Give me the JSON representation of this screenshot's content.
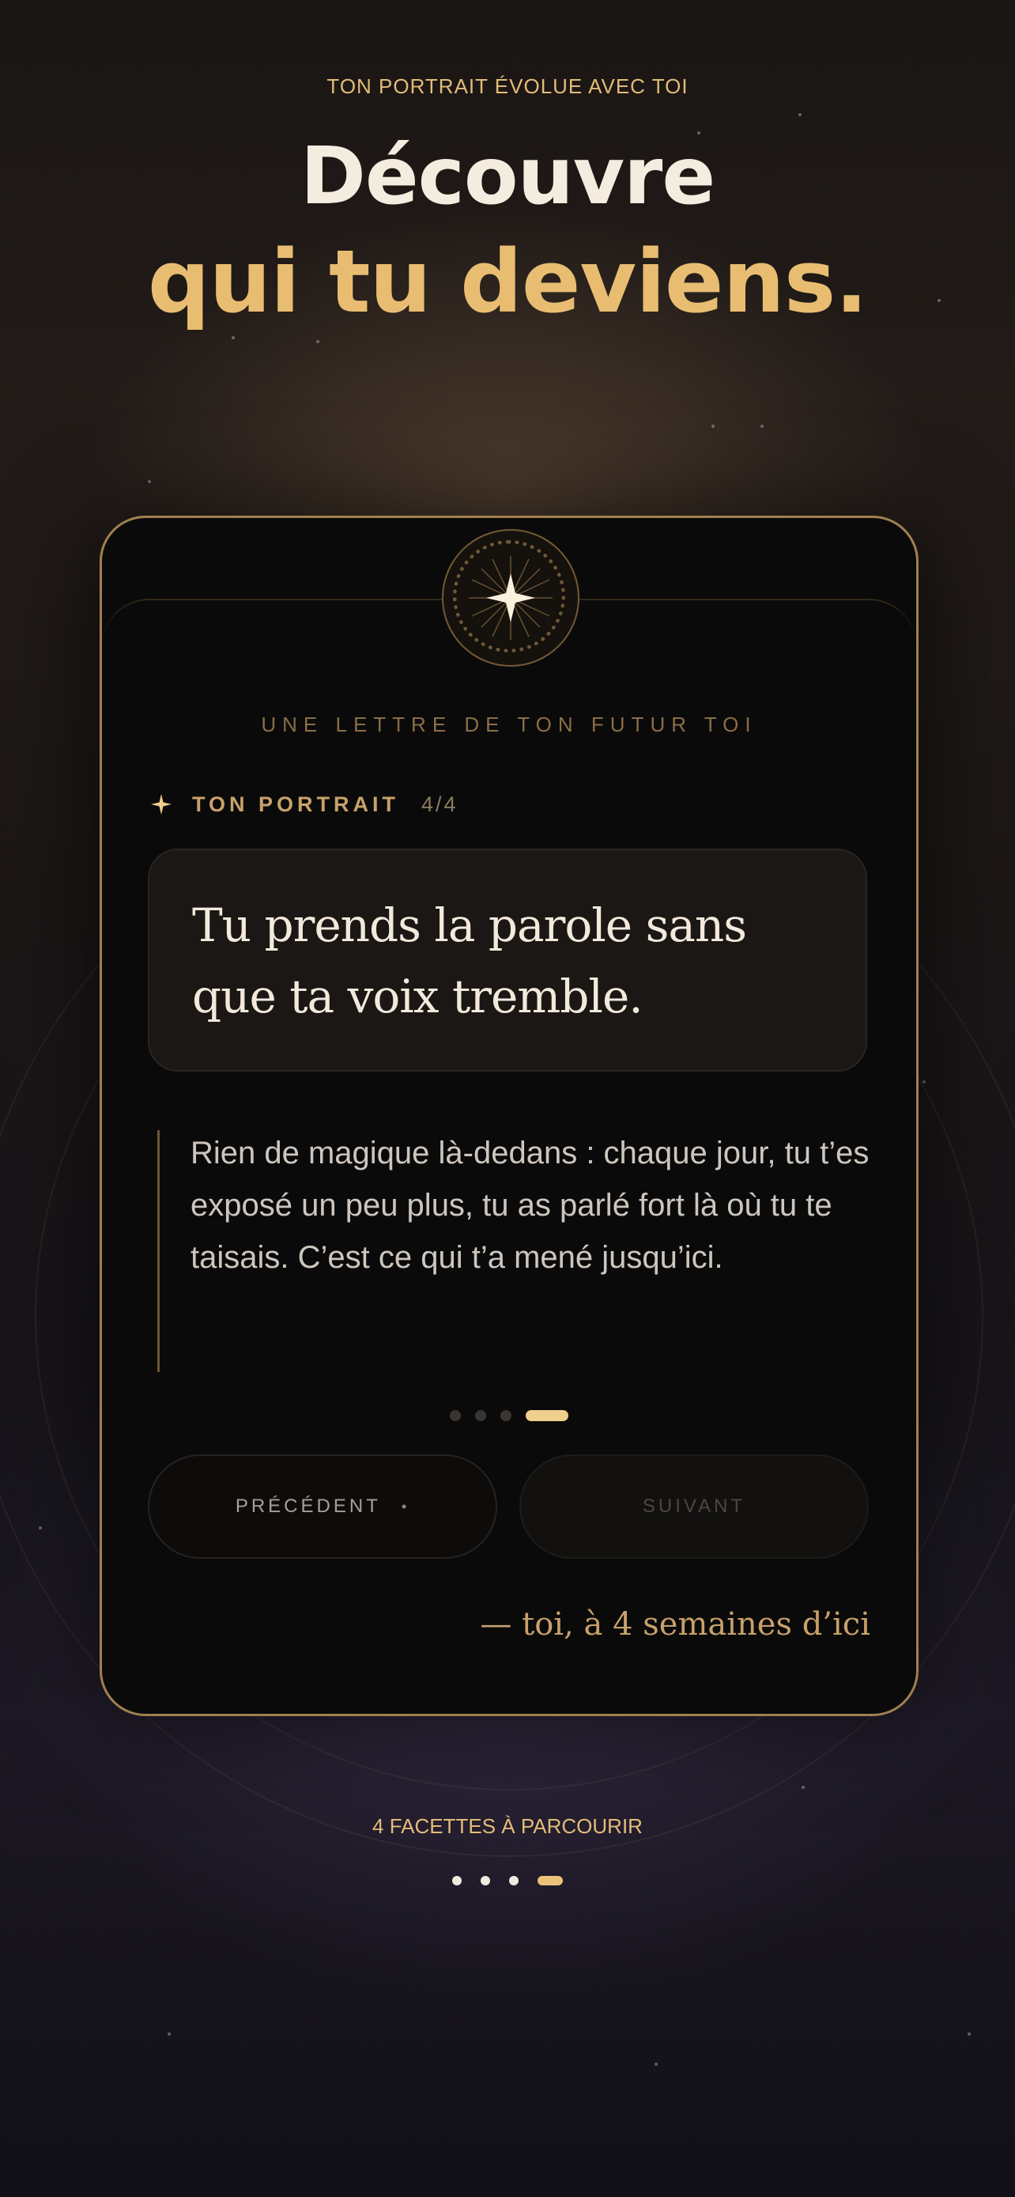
{
  "header": {
    "eyebrow": "TON PORTRAIT ÉVOLUE AVEC TOI",
    "title_line1": "Découvre",
    "title_line2": "qui tu deviens."
  },
  "card": {
    "letter_label": "UNE LETTRE DE TON FUTUR TOI",
    "portrait_label": "TON PORTRAIT",
    "portrait_count": "4/4",
    "quote": "Tu prends la parole sans que ta voix tremble.",
    "body": "Rien de magique là-dedans : chaque jour, tu t’es exposé un peu plus, tu as parlé fort là où tu te taisais. C’est ce qui t’a mené jusqu’ici.",
    "pager": {
      "total": 4,
      "current": 4
    },
    "prev_label": "PRÉCÉDENT",
    "next_label": "SUIVANT",
    "signature": "— toi, à 4 semaines d’ici"
  },
  "footer": {
    "facettes_label": "4 FACETTES À PARCOURIR",
    "pager": {
      "total": 4,
      "current": 4
    }
  },
  "colors": {
    "accent_gold": "#e8bd72",
    "card_border": "#a0804e",
    "active_dot": "#f0cf8c"
  },
  "icons": {
    "emblem": "compass-star-icon",
    "portrait": "sparkle-icon"
  }
}
